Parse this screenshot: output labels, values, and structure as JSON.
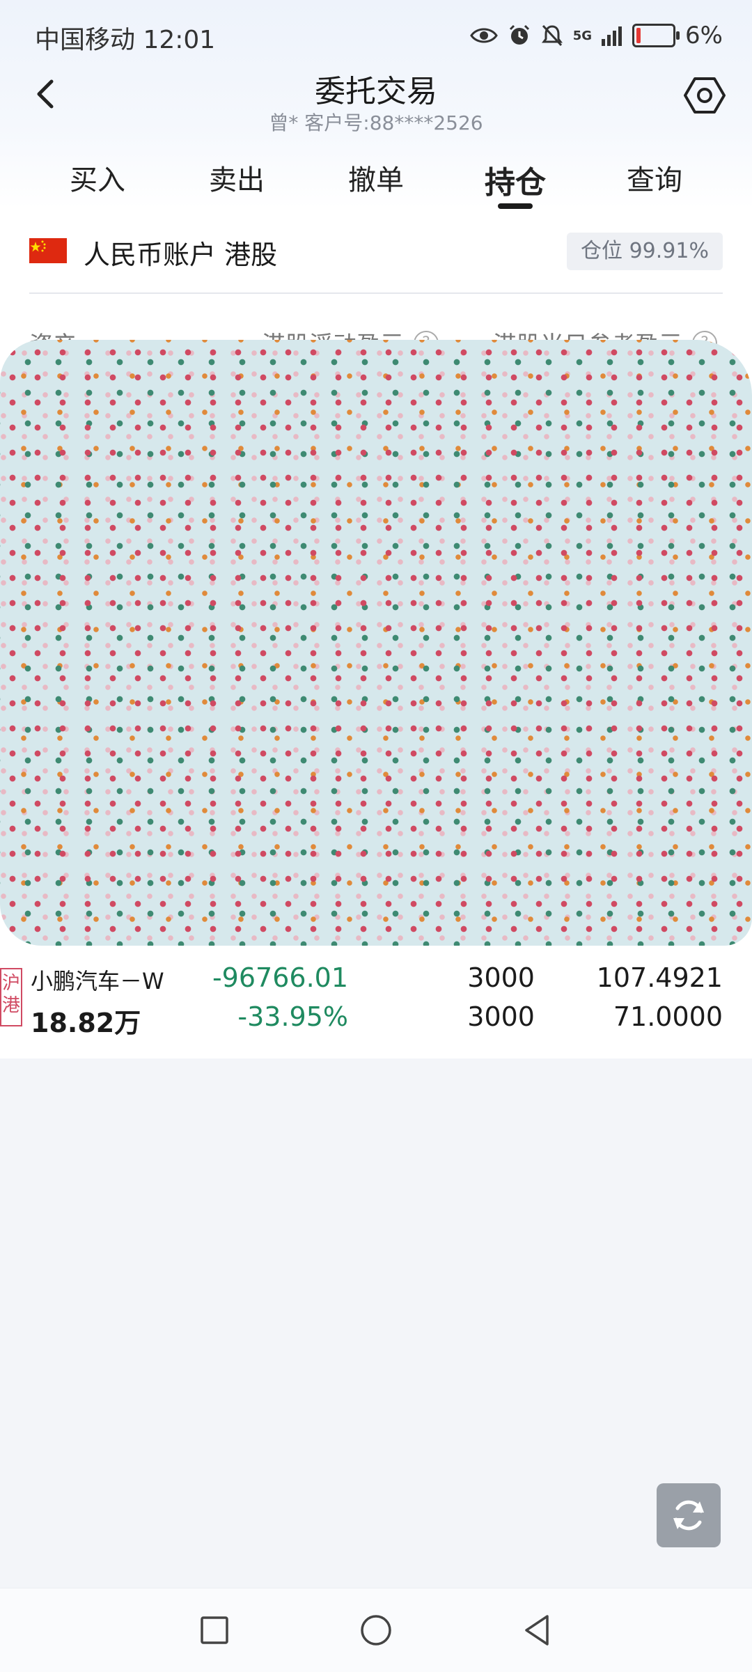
{
  "status_bar": {
    "carrier_time": "中国移动 12:01",
    "signal": "5G",
    "battery": "6%",
    "icons": [
      "eye-icon",
      "alarm-icon",
      "mute-icon",
      "signal-icon",
      "battery-icon"
    ]
  },
  "header": {
    "title": "委托交易",
    "subtitle": "曾* 客户号:88****2526"
  },
  "tabs": [
    {
      "label": "买入"
    },
    {
      "label": "卖出"
    },
    {
      "label": "撤单"
    },
    {
      "label": "持仓",
      "active": true
    },
    {
      "label": "查询"
    }
  ],
  "account": {
    "label": "人民币账户 港股",
    "position_badge": "仓位 99.91%"
  },
  "stats": {
    "asset_label": "资产",
    "floating_pl_label": "港股浮动盈亏",
    "daily_pl_label": "港股当日参考盈亏"
  },
  "holding": {
    "market_tag": "沪港",
    "name": "小鹏汽车－W",
    "market_value": "18.82万",
    "profit_loss": "-96766.01",
    "profit_loss_pct": "-33.95%",
    "quantity": "3000",
    "available": "3000",
    "cost_price": "107.4921",
    "current_price": "71.0000"
  },
  "colors": {
    "loss_green": "#1f8a60",
    "tag_red": "#d04a62",
    "page_bg": "#f3f5f9"
  }
}
